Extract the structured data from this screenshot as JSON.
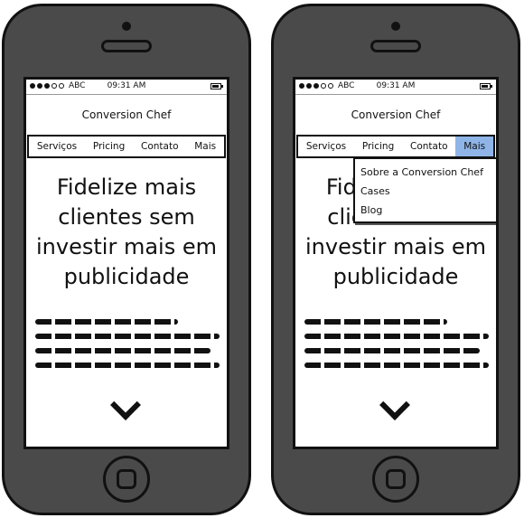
{
  "status_bar": {
    "carrier": "ABC",
    "time": "09:31 AM"
  },
  "app_title": "Conversion Chef",
  "nav": {
    "items": [
      {
        "label": "Serviços"
      },
      {
        "label": "Pricing"
      },
      {
        "label": "Contato"
      },
      {
        "label": "Mais"
      }
    ]
  },
  "hero": {
    "headline": "Fidelize mais clientes sem investir mais em publicidade"
  },
  "dropdown": {
    "items": [
      {
        "label": "Sobre a Conversion Chef"
      },
      {
        "label": "Cases"
      },
      {
        "label": "Blog"
      }
    ]
  },
  "colors": {
    "phone_body": "#4a4a4a",
    "outline": "#111111",
    "active_tab": "#8fb5e8"
  },
  "icons": {
    "scroll_down": "chevron-down-icon",
    "battery": "battery-icon"
  }
}
